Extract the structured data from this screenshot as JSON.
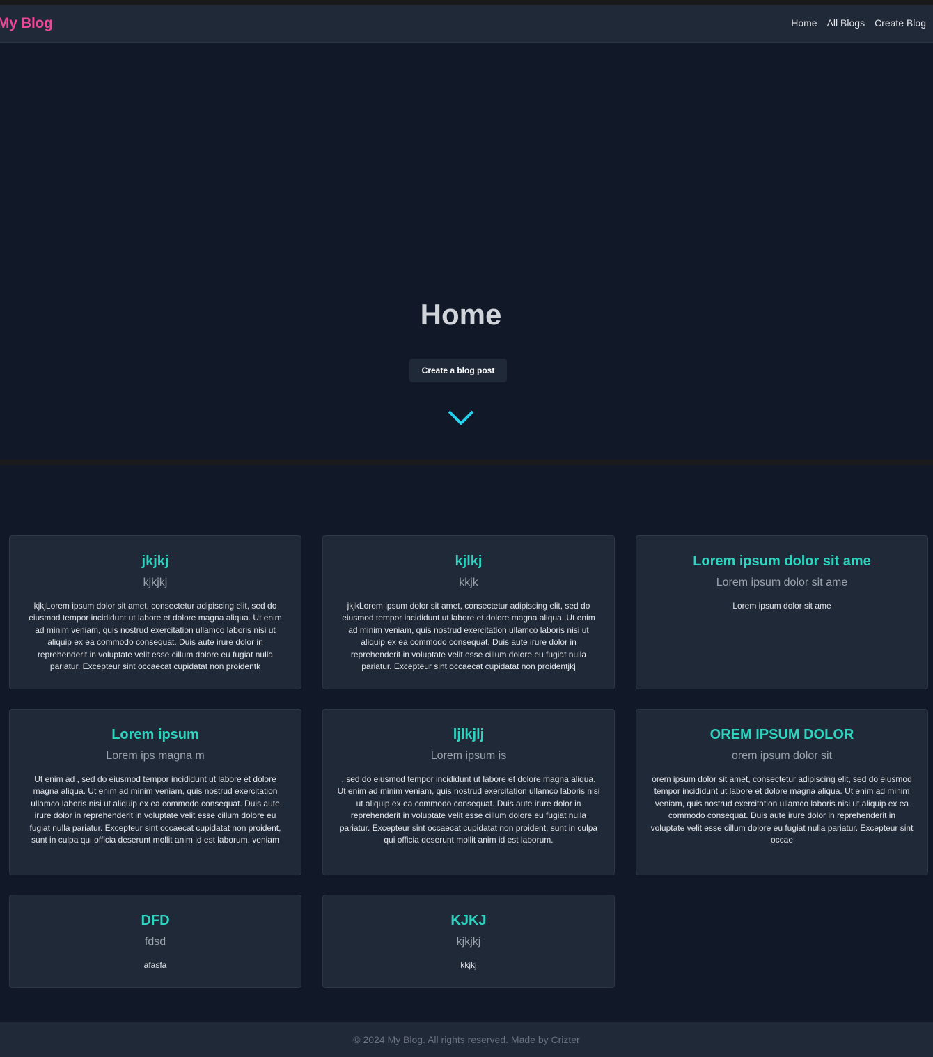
{
  "brand": "My Blog",
  "nav": {
    "home": "Home",
    "all_blogs": "All Blogs",
    "create_blog": "Create Blog"
  },
  "hero": {
    "title": "Home",
    "button": "Create a blog post",
    "scroll_icon": "chevron-down-icon",
    "accent": "#22d3ee"
  },
  "posts": [
    {
      "title": "jkjkj",
      "subtitle": "kjkjkj",
      "body": "kjkjLorem ipsum dolor sit amet, consectetur adipiscing elit, sed do eiusmod tempor incididunt ut labore et dolore magna aliqua. Ut enim ad minim veniam, quis nostrud exercitation ullamco laboris nisi ut aliquip ex ea commodo consequat. Duis aute irure dolor in reprehenderit in voluptate velit esse cillum dolore eu fugiat nulla pariatur. Excepteur sint occaecat cupidatat non proidentk"
    },
    {
      "title": "kjlkj",
      "subtitle": "kkjk",
      "body": "jkjkLorem ipsum dolor sit amet, consectetur adipiscing elit, sed do eiusmod tempor incididunt ut labore et dolore magna aliqua. Ut enim ad minim veniam, quis nostrud exercitation ullamco laboris nisi ut aliquip ex ea commodo consequat. Duis aute irure dolor in reprehenderit in voluptate velit esse cillum dolore eu fugiat nulla pariatur. Excepteur sint occaecat cupidatat non proidentjkj"
    },
    {
      "title": "Lorem ipsum dolor sit ame",
      "subtitle": "Lorem ipsum dolor sit ame",
      "body": "Lorem ipsum dolor sit ame"
    },
    {
      "title": "Lorem ipsum",
      "subtitle": "Lorem ips magna m",
      "body": "Ut enim ad , sed do eiusmod tempor incididunt ut labore et dolore magna aliqua. Ut enim ad minim veniam, quis nostrud exercitation ullamco laboris nisi ut aliquip ex ea commodo consequat. Duis aute irure dolor in reprehenderit in voluptate velit esse cillum dolore eu fugiat nulla pariatur. Excepteur sint occaecat cupidatat non proident, sunt in culpa qui officia deserunt mollit anim id est laborum. veniam"
    },
    {
      "title": "ljlkjlj",
      "subtitle": "Lorem ipsum is",
      "body": ", sed do eiusmod tempor incididunt ut labore et dolore magna aliqua. Ut enim ad minim veniam, quis nostrud exercitation ullamco laboris nisi ut aliquip ex ea commodo consequat. Duis aute irure dolor in reprehenderit in voluptate velit esse cillum dolore eu fugiat nulla pariatur. Excepteur sint occaecat cupidatat non proident, sunt in culpa qui officia deserunt mollit anim id est laborum."
    },
    {
      "title": "OREM IPSUM DOLOR",
      "subtitle": "orem ipsum dolor sit",
      "body": "orem ipsum dolor sit amet, consectetur adipiscing elit, sed do eiusmod tempor incididunt ut labore et dolore magna aliqua. Ut enim ad minim veniam, quis nostrud exercitation ullamco laboris nisi ut aliquip ex ea commodo consequat. Duis aute irure dolor in reprehenderit in voluptate velit esse cillum dolore eu fugiat nulla pariatur. Excepteur sint occae"
    },
    {
      "title": "DFD",
      "subtitle": "fdsd",
      "body": "afasfa"
    },
    {
      "title": "KJKJ",
      "subtitle": "kjkjkj",
      "body": "kkjkj"
    }
  ],
  "footer": "© 2024 My Blog. All rights reserved. Made by Crizter",
  "colors": {
    "brand": "#ec4899",
    "card_title": "#2dd4bf",
    "background": "#111827",
    "surface": "#1f2937"
  }
}
